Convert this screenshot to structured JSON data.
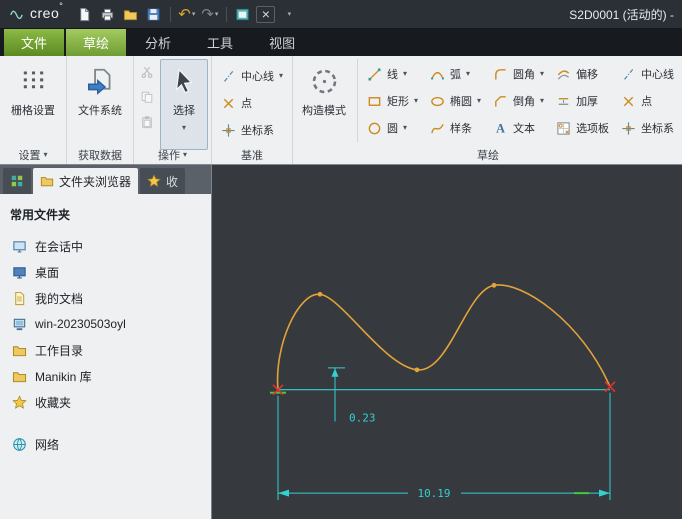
{
  "titlebar": {
    "app_name": "creo",
    "app_mark": "°",
    "window_title": "S2D0001 (活动的) -"
  },
  "tabs": {
    "file": "文件",
    "sketch": "草绘",
    "analysis": "分析",
    "tools": "工具",
    "view": "视图"
  },
  "ribbon": {
    "settings": {
      "label": "设置",
      "grid_button": "栅格设置"
    },
    "get_data": {
      "label": "获取数据",
      "filesystem_button": "文件系统"
    },
    "operations": {
      "label": "操作",
      "select_button": "选择"
    },
    "datum": {
      "label": "基准",
      "items": [
        {
          "label": "中心线"
        },
        {
          "label": "点"
        },
        {
          "label": "坐标系"
        }
      ]
    },
    "sketch": {
      "label": "草绘",
      "construction_button": "构造模式",
      "tools": [
        {
          "label": "线"
        },
        {
          "label": "矩形"
        },
        {
          "label": "圆"
        },
        {
          "label": "弧"
        },
        {
          "label": "椭圆"
        },
        {
          "label": "样条"
        },
        {
          "label": "圆角"
        },
        {
          "label": "倒角"
        },
        {
          "label": "文本"
        },
        {
          "label": "偏移"
        },
        {
          "label": "加厚"
        },
        {
          "label": "选项板"
        },
        {
          "label": "中心线"
        },
        {
          "label": "点"
        },
        {
          "label": "坐标系"
        }
      ]
    }
  },
  "panel": {
    "browser_tab": "文件夹浏览器",
    "fav_tab": "收",
    "header": "常用文件夹",
    "folders": [
      {
        "icon": "session",
        "label": "在会话中"
      },
      {
        "icon": "desktop",
        "label": "桌面"
      },
      {
        "icon": "document",
        "label": "我的文档"
      },
      {
        "icon": "computer",
        "label": "win-20230503oyl"
      },
      {
        "icon": "folder",
        "label": "工作目录"
      },
      {
        "icon": "folder",
        "label": "Manikin 库"
      },
      {
        "icon": "favorites",
        "label": "收藏夹"
      }
    ],
    "network": {
      "icon": "network",
      "label": "网络"
    }
  },
  "canvas": {
    "dim_offset": "0.23",
    "dim_width": "10.19",
    "colors": {
      "curve": "#e2a33a",
      "dimension": "#33d1d1",
      "endpoint": "#e23030",
      "handle": "#3ecb3e",
      "background": "#36393d"
    }
  }
}
